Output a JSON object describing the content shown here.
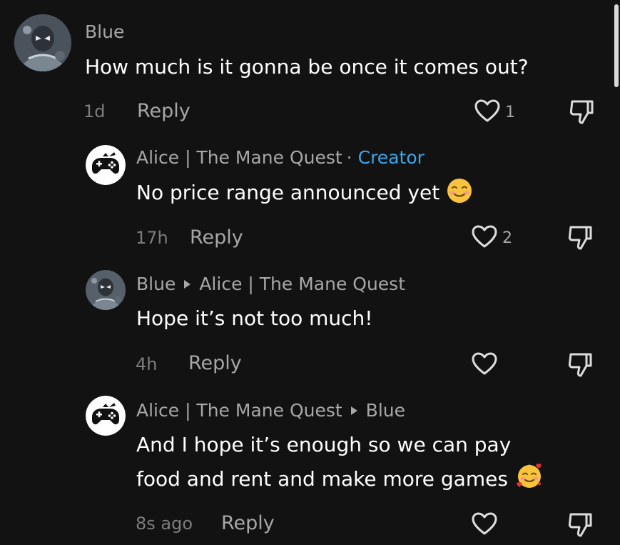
{
  "comments": [
    {
      "author": "Blue",
      "text": "How much is it gonna be once it comes out?",
      "time": "1d",
      "reply_label": "Reply",
      "like_count": "1"
    },
    {
      "author": "Alice | The Mane Quest",
      "separator": "·",
      "badge": "Creator",
      "text": "No price range announced yet",
      "time": "17h",
      "reply_label": "Reply",
      "like_count": "2"
    },
    {
      "author": "Blue",
      "reply_to": "Alice | The Mane Quest",
      "text": "Hope it’s not too much!",
      "time": "4h",
      "reply_label": "Reply",
      "like_count": ""
    },
    {
      "author": "Alice | The Mane Quest",
      "reply_to": "Blue",
      "text_line1": "And I hope it’s enough so we can pay",
      "text_line2": "food and rent and make more games",
      "time": "8s ago",
      "reply_label": "Reply",
      "like_count": ""
    }
  ],
  "icons": {
    "like": "heart-outline-icon",
    "dislike": "thumbs-down-icon",
    "emoji_1": "smiling-face-emoji",
    "emoji_2": "smiling-face-with-hearts-emoji"
  },
  "colors": {
    "background": "#121212",
    "creator_badge": "#3ea4e9",
    "muted_text": "#a7a7a7"
  }
}
